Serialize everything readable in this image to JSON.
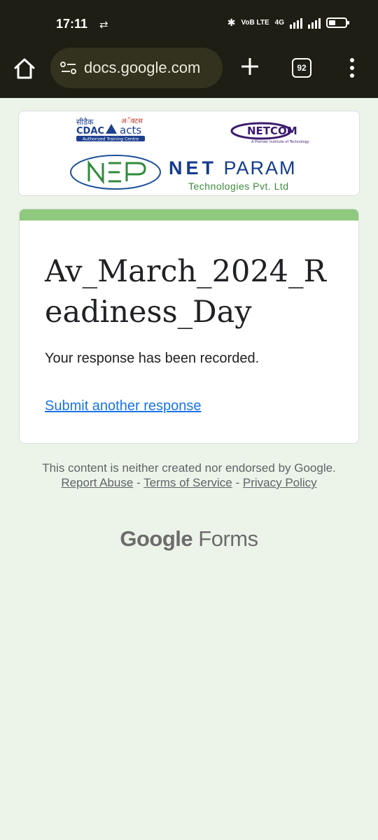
{
  "status": {
    "time": "17:11",
    "volte": "VoB LTE",
    "network": "4G"
  },
  "browser": {
    "url": "docs.google.com",
    "tab_count": "92"
  },
  "logos": {
    "cdac_hindi": "सीडैक",
    "cdac": "CDAC",
    "acts_hindi": "अॅक्टस",
    "acts": "acts",
    "atc_tag": "Authorized Training Centre",
    "netcom": "NETCOM",
    "netcom_tag": "A Premier Institute of Technology",
    "netparam_bold": "NET",
    "netparam_rest": "PARAM",
    "netparam_sub": "Technologies Pvt. Ltd"
  },
  "form": {
    "title": "Av_March_2024_Readiness_Day",
    "confirmation": "Your response has been recorded.",
    "another_link": "Submit another response",
    "accent_color": "#8fc97d"
  },
  "footer": {
    "disclaimer": "This content is neither created nor endorsed by Google.",
    "report_abuse": "Report Abuse",
    "sep1": " - ",
    "terms": "Terms of Service",
    "sep2": " - ",
    "privacy": "Privacy Policy",
    "brand_google": "Google",
    "brand_forms": "Forms"
  }
}
